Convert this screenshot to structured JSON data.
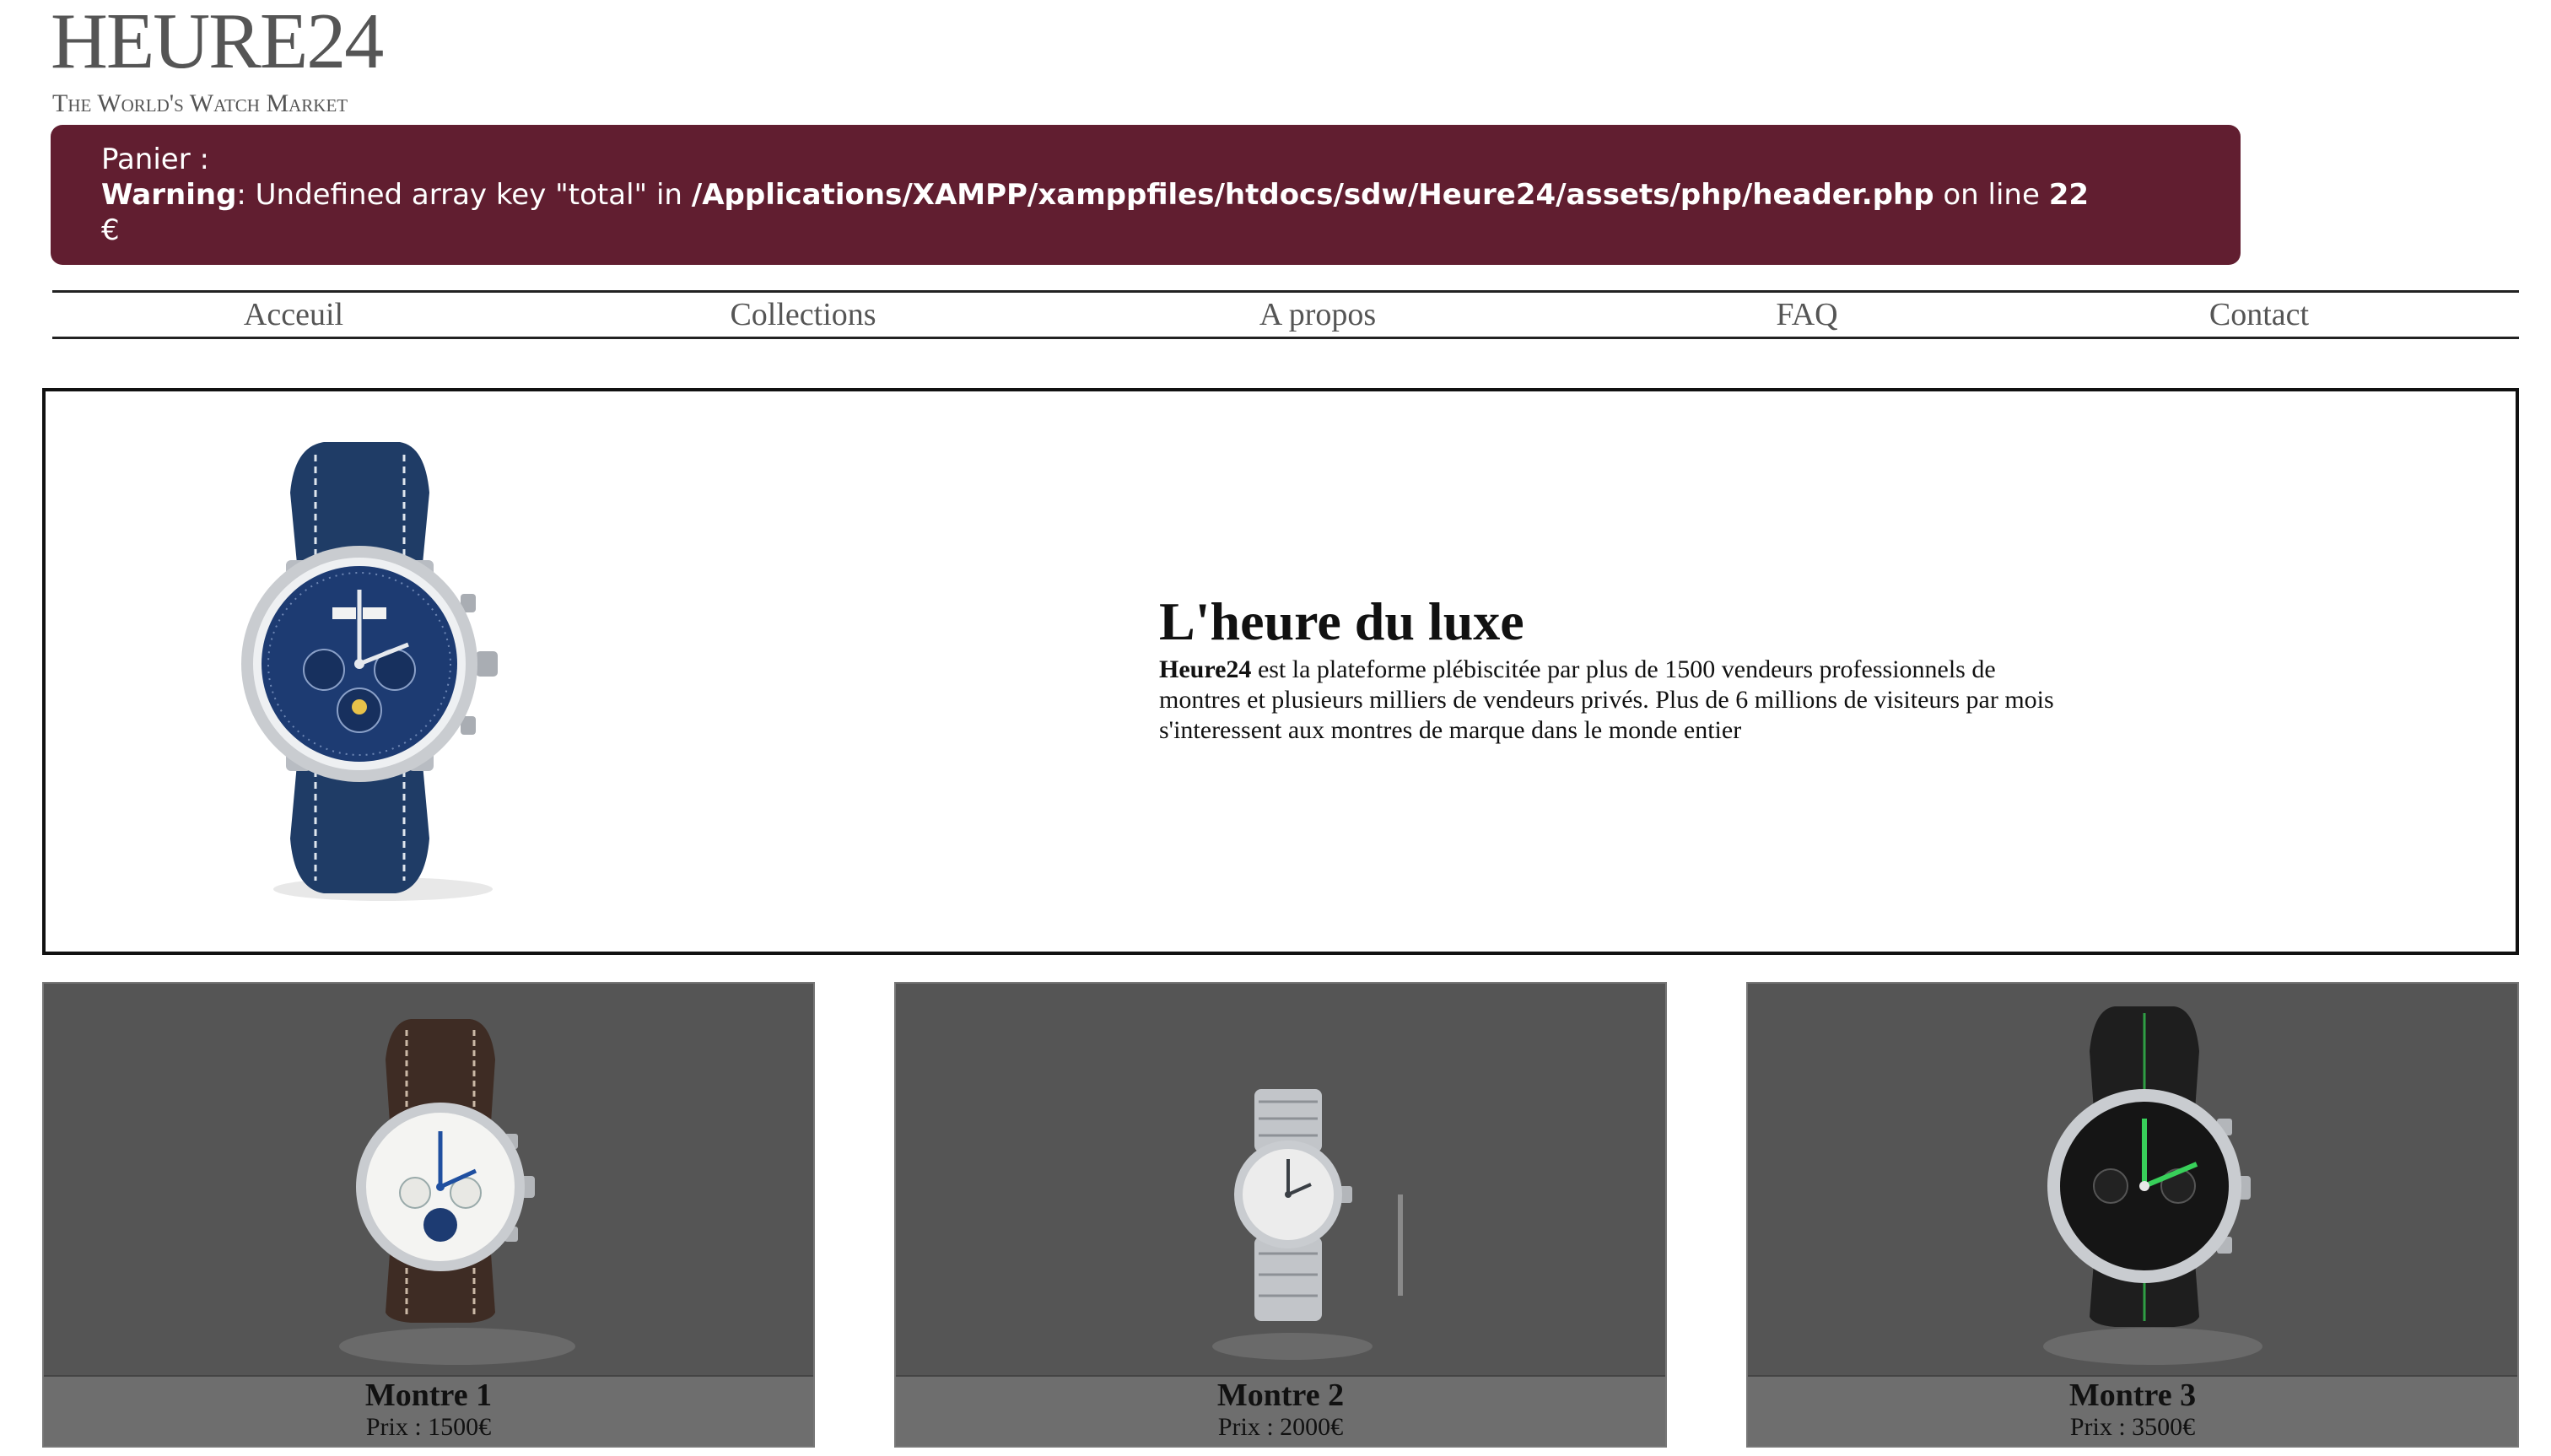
{
  "brand": {
    "logo": "HEURE24",
    "tagline": "The World's Watch Market"
  },
  "cart": {
    "label": "Panier :",
    "warning_label": "Warning",
    "warning_text": ": Undefined array key \"total\" in ",
    "warning_path": "/Applications/XAMPP/xamppfiles/htdocs/sdw/Heure24/assets/php/header.php",
    "warning_online": " on line ",
    "warning_line": "22",
    "currency": "€"
  },
  "nav": {
    "items": [
      "Acceuil",
      "Collections",
      "A propos",
      "FAQ",
      "Contact"
    ]
  },
  "hero": {
    "title": "L'heure du luxe",
    "desc_brand": "Heure24",
    "desc_text": " est la plateforme plébiscitée par plus de 1500 vendeurs professionnels de montres et plusieurs milliers de vendeurs privés. Plus de 6 millions de visiteurs par mois s'interessent aux montres de marque dans le monde entier"
  },
  "products": [
    {
      "name": "Montre 1",
      "price": "Prix : 1500€"
    },
    {
      "name": "Montre 2",
      "price": "Prix : 2000€"
    },
    {
      "name": "Montre 3",
      "price": "Prix : 3500€"
    }
  ],
  "colors": {
    "cart_bg": "#611e30",
    "card_bg": "#555555",
    "caption_bg": "#6e6e6e"
  }
}
